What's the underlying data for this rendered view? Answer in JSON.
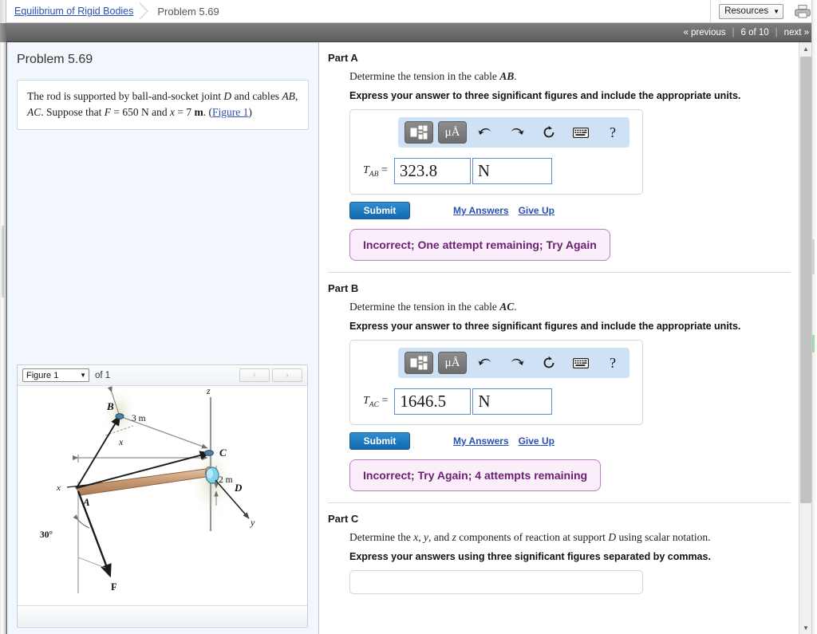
{
  "breadcrumb": {
    "parent": "Equilibrium of Rigid Bodies",
    "current": "Problem 5.69"
  },
  "header": {
    "resources_label": "Resources",
    "resources_caret": "▼",
    "print_icon": "printer-icon"
  },
  "nav": {
    "previous": "« previous",
    "counter": "6 of 10",
    "next": "next »",
    "pipe": "|"
  },
  "left_pane": {
    "title": "Problem 5.69",
    "statement": {
      "l1a": "The rod is supported by ball-and-socket joint ",
      "l1b": "D",
      "l1c": " and",
      "l2a": "cables ",
      "l2b": "AB",
      "l2c": ", ",
      "l2d": "AC",
      "l2e": ". Suppose that ",
      "l2f": "F",
      "l2g": " = 650 ",
      "l2h": "N",
      "l2i": " and ",
      "l2j": "x",
      "l2k": " = 7",
      "l3a": "m",
      "l3b": ". (",
      "l3c": "Figure 1",
      "l3d": ")"
    },
    "figure": {
      "select_value": "Figure 1",
      "select_caret": "▼",
      "of_text": "of 1",
      "prev_arrow": "‹",
      "next_arrow": "›",
      "labels": {
        "z": "z",
        "y": "y",
        "x_axis": "x",
        "x_dim": "x",
        "point_a": "A",
        "point_b": "B",
        "point_c": "C",
        "point_d": "D",
        "force_f": "F",
        "dim_3m": "3 m",
        "dim_2m": "2 m",
        "angle_30": "30°"
      }
    }
  },
  "parts": [
    {
      "id": "part-a",
      "title": "Part A",
      "question_pre": "Determine the tension in the cable ",
      "question_math": "AB",
      "question_post": ".",
      "instruction": "Express your answer to three significant figures and include the appropriate units.",
      "toolbar": {
        "template_btn": "template-icon",
        "units_btn": "μÅ",
        "undo": "↰",
        "redo": "↱",
        "reset": "↻",
        "keyboard": "⌨",
        "help": "?"
      },
      "answer_label_base": "T",
      "answer_label_sub": "AB",
      "answer_equals": "=",
      "answer_value": "323.8",
      "unit_value": "N",
      "submit_label": "Submit",
      "my_answers_label": "My Answers",
      "give_up_label": "Give Up",
      "feedback": "Incorrect; One attempt remaining; Try Again"
    },
    {
      "id": "part-b",
      "title": "Part B",
      "question_pre": "Determine the tension in the cable ",
      "question_math": "AC",
      "question_post": ".",
      "instruction": "Express your answer to three significant figures and include the appropriate units.",
      "toolbar": {
        "template_btn": "template-icon",
        "units_btn": "μÅ",
        "undo": "↰",
        "redo": "↱",
        "reset": "↻",
        "keyboard": "⌨",
        "help": "?"
      },
      "answer_label_base": "T",
      "answer_label_sub": "AC",
      "answer_equals": "=",
      "answer_value": "1646.5",
      "unit_value": "N",
      "submit_label": "Submit",
      "my_answers_label": "My Answers",
      "give_up_label": "Give Up",
      "feedback": "Incorrect; Try Again; 4 attempts remaining"
    }
  ],
  "part_c": {
    "title": "Part C",
    "q_pre": "Determine the ",
    "q_x": "x",
    "q_c1": ", ",
    "q_y": "y",
    "q_c2": ", and ",
    "q_z": "z",
    "q_mid": " components of reaction at support ",
    "q_d": "D",
    "q_post": " using scalar notation.",
    "instruction": "Express your answers using three significant figures separated by commas."
  },
  "colors": {
    "link": "#2a4fb5",
    "submit": "#1268ae",
    "feedback_text": "#6b1f72",
    "feedback_bg": "#faeefb",
    "toolbar_bg": "#cfe1f5",
    "left_pane_bg": "#f2f7fd",
    "navband": "#6f6f6f"
  }
}
